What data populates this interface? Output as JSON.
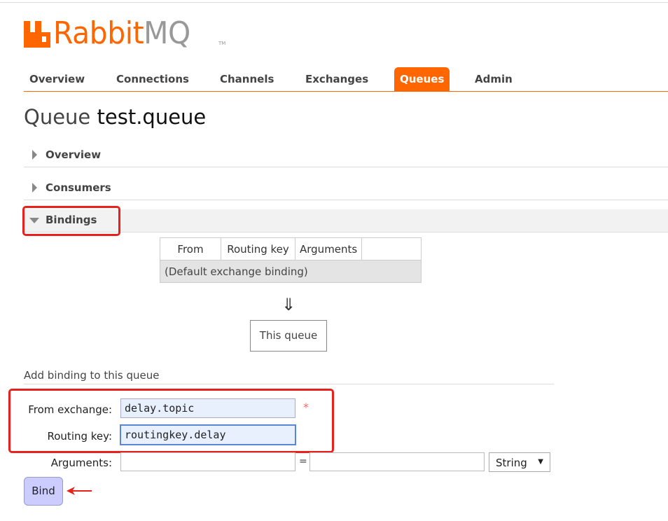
{
  "brand": {
    "logo_text_rabbit": "Rabbit",
    "logo_text_mq": "MQ",
    "trademark": "TM",
    "accent": "#ff6600"
  },
  "nav": {
    "items": [
      "Overview",
      "Connections",
      "Channels",
      "Exchanges",
      "Queues",
      "Admin"
    ],
    "active": "Queues"
  },
  "page": {
    "title_prefix": "Queue",
    "queue_name": "test.queue"
  },
  "sections": {
    "overview": "Overview",
    "consumers": "Consumers",
    "bindings": "Bindings"
  },
  "bindings_table": {
    "headers": [
      "From",
      "Routing key",
      "Arguments"
    ],
    "row": "(Default exchange binding)"
  },
  "flow": {
    "arrow": "⇓",
    "this_queue": "This queue"
  },
  "add_binding": {
    "title": "Add binding to this queue",
    "from_exchange_label": "From exchange:",
    "from_exchange_value": "delay.topic",
    "required_mark": "*",
    "routing_key_label": "Routing key:",
    "routing_key_value": "routingkey.delay",
    "arguments_label": "Arguments:",
    "argument_key": "",
    "argument_value": "",
    "equals": "=",
    "type_selected": "String",
    "bind_button": "Bind"
  },
  "highlight_color": "#e8211d"
}
